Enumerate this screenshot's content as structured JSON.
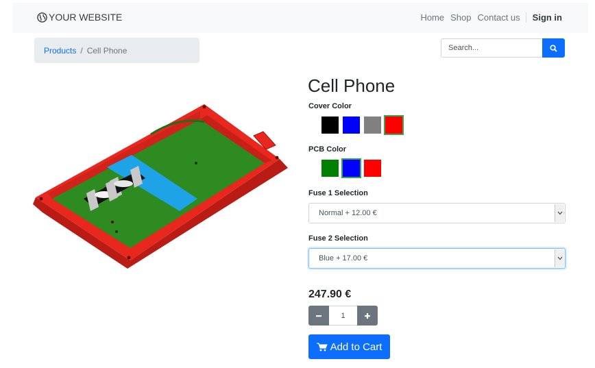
{
  "navbar": {
    "brand": "YOUR WEBSITE",
    "brand_icon": "globe-icon",
    "links": [
      "Home",
      "Shop",
      "Contact us"
    ],
    "signin": "Sign in"
  },
  "breadcrumb": {
    "link": "Products",
    "separator": "/",
    "current": "Cell Phone"
  },
  "search": {
    "placeholder": "Search...",
    "icon": "search-icon"
  },
  "product": {
    "title": "Cell Phone",
    "cover_color": {
      "label": "Cover Color",
      "options": [
        "#000000",
        "#0000ff",
        "#808080",
        "#ff0000"
      ],
      "selected_index": 3
    },
    "pcb_color": {
      "label": "PCB Color",
      "options": [
        "#008000",
        "#0000ff",
        "#ff0000"
      ],
      "selected_index": 1
    },
    "fuse1": {
      "label": "Fuse 1 Selection",
      "value": "Normal + 12.00 €"
    },
    "fuse2": {
      "label": "Fuse 2 Selection",
      "value": "Blue + 17.00 €"
    },
    "price": "247.90 €",
    "quantity": "1",
    "add_to_cart": "Add to Cart",
    "cart_icon": "cart-icon"
  },
  "colors": {
    "primary": "#0d6efd",
    "secondary": "#6c757d",
    "case_red": "#e8271f",
    "pcb_green": "#2e8b22",
    "battery_blue": "#1ea3e6"
  }
}
